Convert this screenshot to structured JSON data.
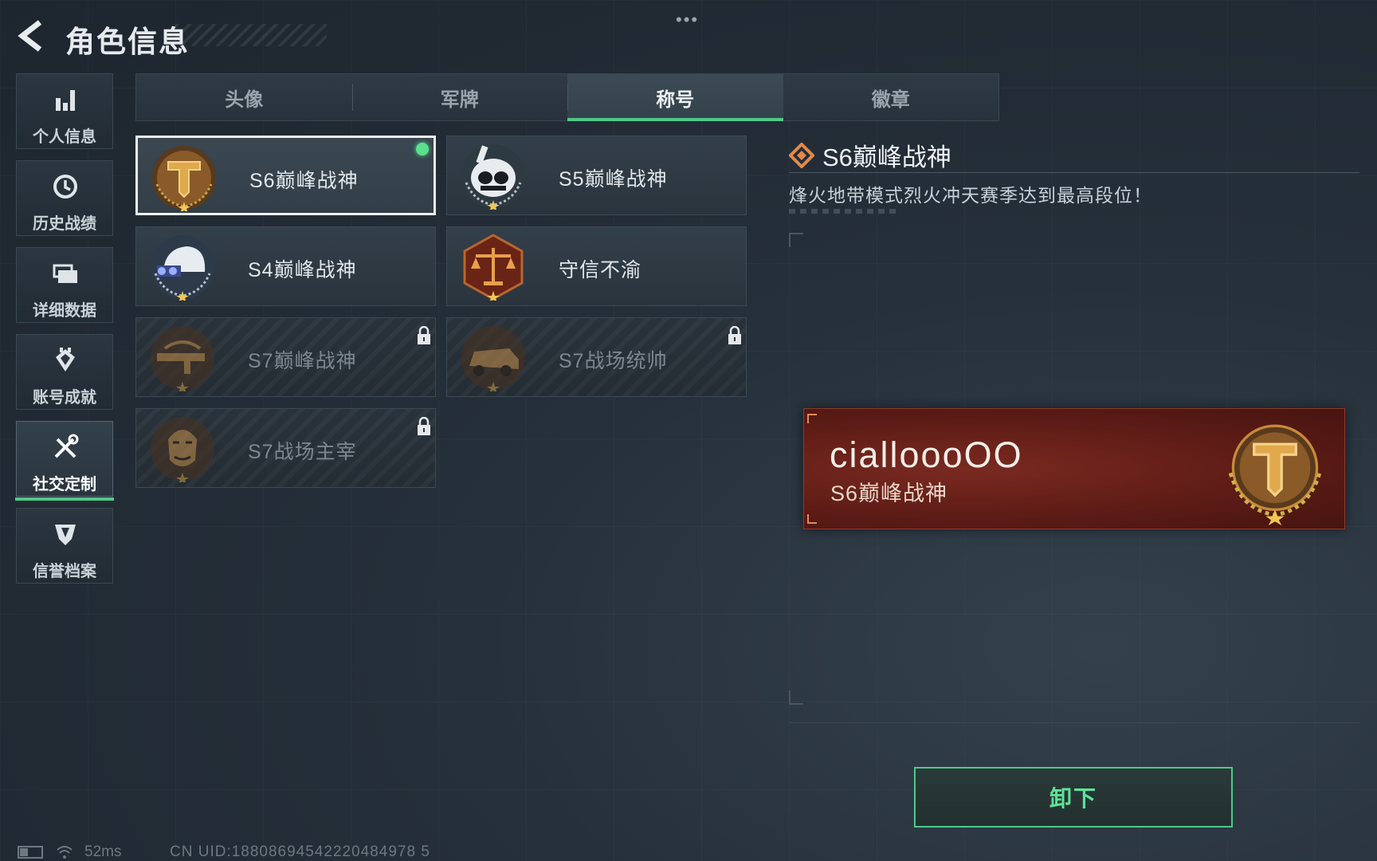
{
  "header": {
    "title": "角色信息",
    "more_label": "•••"
  },
  "sidebar": {
    "items": [
      {
        "label": "个人信息",
        "icon": "bar-chart-icon",
        "active": false
      },
      {
        "label": "历史战绩",
        "icon": "clock-history-icon",
        "active": false
      },
      {
        "label": "详细数据",
        "icon": "folder-icon",
        "active": false
      },
      {
        "label": "账号成就",
        "icon": "achievement-icon",
        "active": false
      },
      {
        "label": "社交定制",
        "icon": "tools-icon",
        "active": true
      },
      {
        "label": "信誉档案",
        "icon": "shield-icon",
        "active": false
      }
    ]
  },
  "tabs": [
    {
      "label": "头像",
      "active": false
    },
    {
      "label": "军牌",
      "active": false
    },
    {
      "label": "称号",
      "active": true
    },
    {
      "label": "徽章",
      "active": false
    }
  ],
  "titles": [
    {
      "name": "S6巅峰战神",
      "emblem": "golden-t-emblem",
      "selected": true,
      "equipped": true,
      "locked": false
    },
    {
      "name": "S5巅峰战神",
      "emblem": "skull-helmet-emblem",
      "selected": false,
      "equipped": false,
      "locked": false
    },
    {
      "name": "S4巅峰战神",
      "emblem": "nvg-helmet-emblem",
      "selected": false,
      "equipped": false,
      "locked": false
    },
    {
      "name": "守信不渝",
      "emblem": "scales-emblem",
      "selected": false,
      "equipped": false,
      "locked": false
    },
    {
      "name": "S7巅峰战神",
      "emblem": "rifle-emblem",
      "selected": false,
      "equipped": false,
      "locked": true
    },
    {
      "name": "S7战场统帅",
      "emblem": "armored-vehicle-emblem",
      "selected": false,
      "equipped": false,
      "locked": true
    },
    {
      "name": "S7战场主宰",
      "emblem": "soldier-portrait-emblem",
      "selected": false,
      "equipped": false,
      "locked": true
    }
  ],
  "detail": {
    "title": "S6巅峰战神",
    "description": "烽火地带模式烈火冲天赛季达到最高段位！"
  },
  "nameplate": {
    "player_name": "cialloooOO",
    "title": "S6巅峰战神"
  },
  "actions": {
    "unequip_label": "卸下"
  },
  "status": {
    "ping": "52ms",
    "uid": "CN UID:18808694542220484978 5"
  },
  "colors": {
    "accent_green": "#4fc98a",
    "nameplate_red": "#6b2119",
    "gold": "#c88a3a"
  }
}
